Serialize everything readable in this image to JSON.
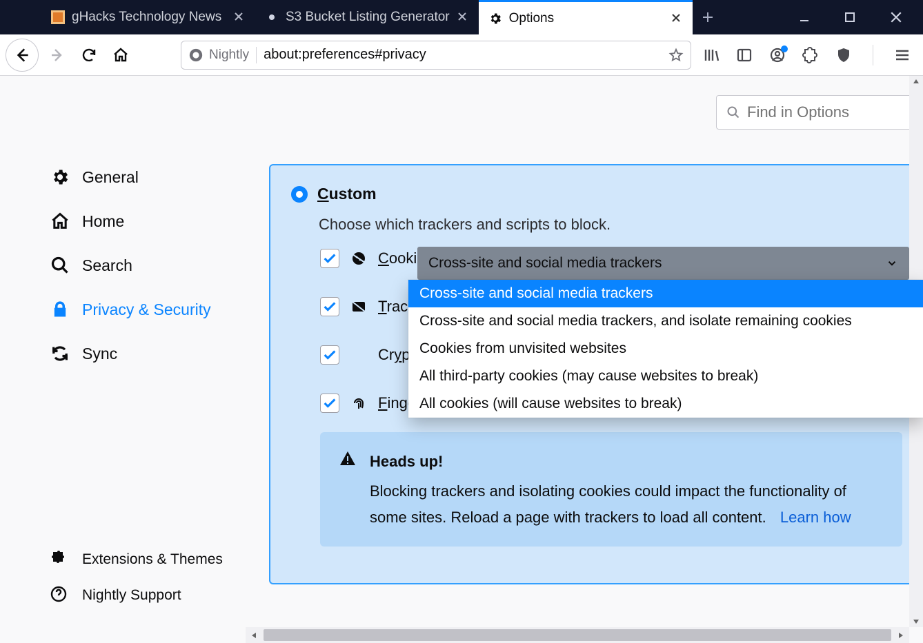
{
  "tabs": [
    {
      "label": "gHacks Technology News",
      "active": false
    },
    {
      "label": "S3 Bucket Listing Generator",
      "active": false
    },
    {
      "label": "Options",
      "active": true
    }
  ],
  "urlbar": {
    "identity_label": "Nightly",
    "url": "about:preferences#privacy"
  },
  "search": {
    "placeholder": "Find in Options"
  },
  "sidebar": {
    "items": [
      {
        "label": "General"
      },
      {
        "label": "Home"
      },
      {
        "label": "Search"
      },
      {
        "label": "Privacy & Security"
      },
      {
        "label": "Sync"
      }
    ],
    "bottom": [
      {
        "label": "Extensions & Themes"
      },
      {
        "label": "Nightly Support"
      }
    ]
  },
  "panel": {
    "radio_label_html": "Custom",
    "desc": "Choose which trackers and scripts to block.",
    "options": {
      "cookies": "Cookies",
      "tracking": "Trackin",
      "crypto": "Crypto",
      "fingerprinters": "Fingerprinters"
    },
    "select": {
      "current": "Cross-site and social media trackers",
      "options": [
        "Cross-site and social media trackers",
        "Cross-site and social media trackers, and isolate remaining cookies",
        "Cookies from unvisited websites",
        "All third-party cookies (may cause websites to break)",
        "All cookies (will cause websites to break)"
      ]
    },
    "callout": {
      "title": "Heads up!",
      "body": "Blocking trackers and isolating cookies could impact the functionality of some sites. Reload a page with trackers to load all content.",
      "link": "Learn how"
    }
  }
}
